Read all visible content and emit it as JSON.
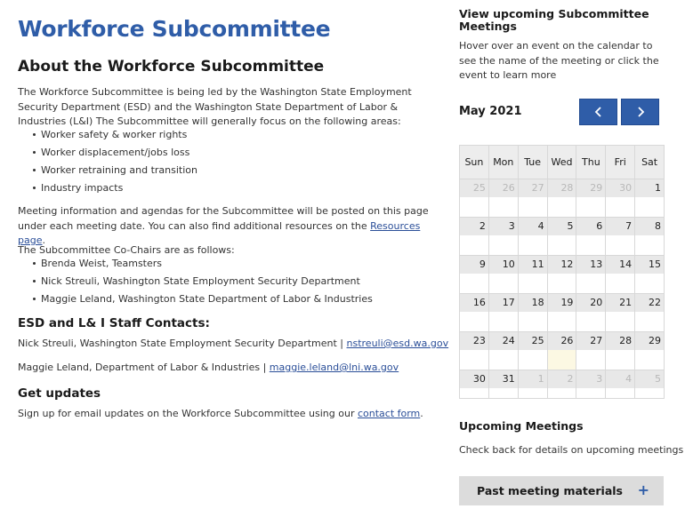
{
  "page": {
    "title": "Workforce Subcommittee",
    "about_heading": "About the Workforce Subcommittee",
    "intro": "The Workforce Subcommittee is being led by the Washington State Employment Security Department (ESD) and the Washington State Department of Labor & Industries (L&I) The Subcommittee will generally focus on the following areas:",
    "focus_areas": [
      "Worker safety & worker rights",
      "Worker displacement/jobs loss",
      "Worker retraining and transition",
      "Industry impacts"
    ],
    "meeting_info_prefix": "Meeting information and agendas for the Subcommittee will be posted on this page under each meeting date. You can also find additional resources on the ",
    "resources_link": "Resources page",
    "meeting_info_suffix": ".",
    "cochairs_intro": "The Subcommittee Co-Chairs are as follows:",
    "cochairs": [
      "Brenda Weist, Teamsters",
      "Nick Streuli, Washington State Employment Security Department",
      "Maggie Leland, Washington State Department of Labor & Industries"
    ],
    "contacts_heading": "ESD and L& I Staff Contacts:",
    "contact1_text": "Nick Streuli, Washington State Employment Security Department | ",
    "contact1_email": "nstreuli@esd.wa.gov",
    "contact2_text": "Maggie Leland, Department of Labor & Industries | ",
    "contact2_email": "maggie.leland@lni.wa.gov",
    "updates_heading": "Get updates",
    "updates_text": "Sign up for email updates on the Workforce Subcommittee using our ",
    "contact_form_link": "contact form",
    "updates_suffix": "."
  },
  "sidebar": {
    "title": "View upcoming Subcommittee Meetings",
    "help": "Hover over an event on the calendar to see the name of the meeting or click the event to learn more",
    "month": "May 2021",
    "prev_icon": "chevron-left-icon",
    "next_icon": "chevron-right-icon",
    "weekdays": [
      "Sun",
      "Mon",
      "Tue",
      "Wed",
      "Thu",
      "Fri",
      "Sat"
    ],
    "weeks": [
      [
        {
          "d": "25",
          "o": true
        },
        {
          "d": "26",
          "o": true
        },
        {
          "d": "27",
          "o": true
        },
        {
          "d": "28",
          "o": true
        },
        {
          "d": "29",
          "o": true
        },
        {
          "d": "30",
          "o": true
        },
        {
          "d": "1"
        }
      ],
      [
        {
          "d": "2"
        },
        {
          "d": "3"
        },
        {
          "d": "4"
        },
        {
          "d": "5"
        },
        {
          "d": "6"
        },
        {
          "d": "7"
        },
        {
          "d": "8"
        }
      ],
      [
        {
          "d": "9"
        },
        {
          "d": "10"
        },
        {
          "d": "11"
        },
        {
          "d": "12"
        },
        {
          "d": "13"
        },
        {
          "d": "14"
        },
        {
          "d": "15"
        }
      ],
      [
        {
          "d": "16"
        },
        {
          "d": "17"
        },
        {
          "d": "18"
        },
        {
          "d": "19"
        },
        {
          "d": "20"
        },
        {
          "d": "21"
        },
        {
          "d": "22"
        }
      ],
      [
        {
          "d": "23"
        },
        {
          "d": "24"
        },
        {
          "d": "25"
        },
        {
          "d": "26",
          "today": true
        },
        {
          "d": "27"
        },
        {
          "d": "28"
        },
        {
          "d": "29"
        }
      ],
      [
        {
          "d": "30"
        },
        {
          "d": "31"
        },
        {
          "d": "1",
          "o": true
        },
        {
          "d": "2",
          "o": true
        },
        {
          "d": "3",
          "o": true
        },
        {
          "d": "4",
          "o": true
        },
        {
          "d": "5",
          "o": true
        }
      ]
    ],
    "upcoming_heading": "Upcoming Meetings",
    "upcoming_text": "Check back for details on upcoming meetings",
    "past_label": "Past meeting materials",
    "past_icon": "plus-icon",
    "accent_color": "#2f5da8",
    "today_color": "#fcf8e3"
  }
}
